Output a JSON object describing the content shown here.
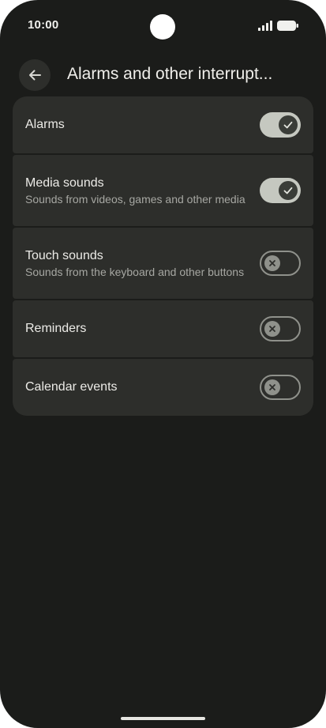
{
  "status_bar": {
    "time": "10:00",
    "icons": [
      "signal-icon",
      "battery-icon"
    ]
  },
  "app_bar": {
    "back_icon": "arrow-back-icon",
    "title": "Alarms and other interrupt..."
  },
  "settings": [
    {
      "title": "Alarms",
      "summary": "",
      "enabled": true
    },
    {
      "title": "Media sounds",
      "summary": "Sounds from videos, games and other media",
      "enabled": true
    },
    {
      "title": "Touch sounds",
      "summary": "Sounds from the keyboard and other buttons",
      "enabled": false
    },
    {
      "title": "Reminders",
      "summary": "",
      "enabled": false
    },
    {
      "title": "Calendar events",
      "summary": "",
      "enabled": false
    }
  ],
  "colors": {
    "background": "#1b1c1a",
    "card": "#2d2e2b",
    "switch_on_track": "#c5c8c0",
    "switch_on_thumb": "#3a3d38",
    "switch_off_outline": "#8f918b"
  }
}
